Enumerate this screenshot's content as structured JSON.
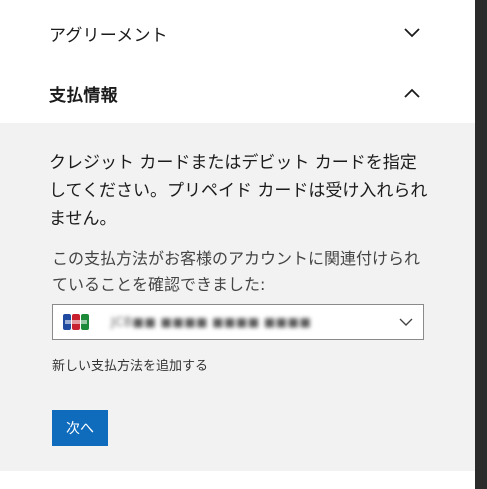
{
  "agreement": {
    "title": "アグリーメント",
    "chevron_icon": "chevron-down-icon"
  },
  "payment": {
    "title": "支払情報",
    "chevron_icon": "chevron-up-icon",
    "instructions": "クレジット カードまたはデビット カードを指定してください。プリペイド カードは受け入れられません。",
    "confirm_text": "この支払方法がお客様のアカウントに関連付けられていることを確認できました:",
    "card": {
      "brand_icon": "jcb-card-icon",
      "number_masked": "JCB■■ ■■■■ ■■■■ ■■■■"
    },
    "add_method_label": "新しい支払方法を追加する",
    "next_label": "次へ"
  },
  "colors": {
    "panel_bg": "#f2f2f2",
    "primary_button": "#0f6cbd"
  }
}
